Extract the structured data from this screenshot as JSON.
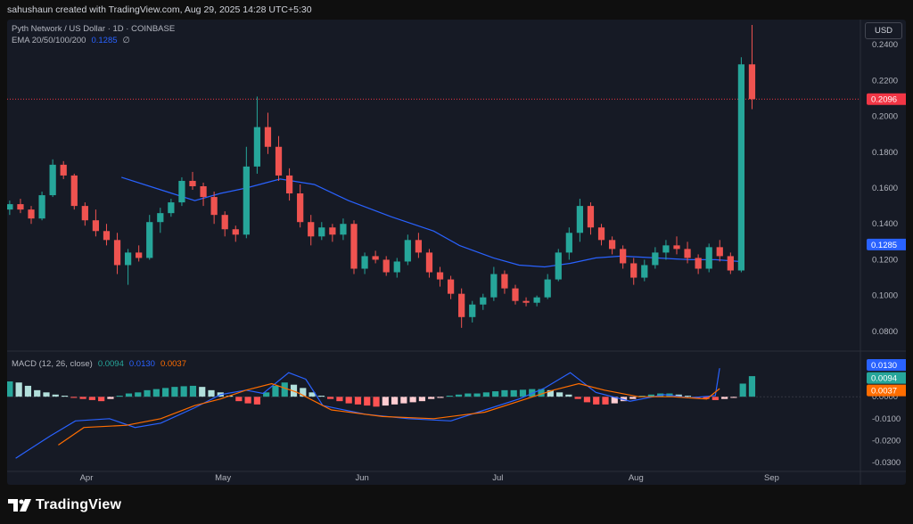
{
  "attribution": "sahushaun created with TradingView.com, Aug 29, 2025 14:28 UTC+5:30",
  "symbol_title": "Pyth Network / US Dollar · 1D · COINBASE",
  "ema_legend": {
    "label": "EMA 20/50/100/200",
    "value": "0.1285"
  },
  "macd_legend": {
    "label": "MACD (12, 26, close)",
    "histogram": "0.0094",
    "macd": "0.0130",
    "signal": "0.0037"
  },
  "currency_button": "USD",
  "brand": "TradingView",
  "colors": {
    "up": "#26a69a",
    "down": "#ef5350",
    "ema": "#2962ff",
    "signal": "#ff6d00",
    "price_line": "#f23645"
  },
  "chart_data": {
    "type": "candlestick",
    "price_axis": {
      "range": [
        0.07,
        0.25
      ],
      "ticks": [
        0.08,
        0.1,
        0.12,
        0.14,
        0.16,
        0.18,
        0.2,
        0.22,
        0.24
      ],
      "tick_labels": [
        "0.0800",
        "0.1000",
        "0.1200",
        "0.1400",
        "0.1600",
        "0.1800",
        "0.2000",
        "0.2200",
        "0.2400"
      ]
    },
    "x_axis": {
      "labels": [
        "Apr",
        "May",
        "Jun",
        "Jul",
        "Aug",
        "Sep"
      ]
    },
    "last_price": 0.2096,
    "last_price_label": "0.2096",
    "ema_value_label": "0.1285",
    "ema_points": [
      [
        0.134,
        0.166
      ],
      [
        0.18,
        0.159
      ],
      [
        0.22,
        0.153
      ],
      [
        0.25,
        0.157
      ],
      [
        0.28,
        0.16
      ],
      [
        0.32,
        0.165
      ],
      [
        0.36,
        0.162
      ],
      [
        0.4,
        0.153
      ],
      [
        0.45,
        0.144
      ],
      [
        0.5,
        0.136
      ],
      [
        0.53,
        0.128
      ],
      [
        0.57,
        0.121
      ],
      [
        0.6,
        0.117
      ],
      [
        0.63,
        0.116
      ],
      [
        0.66,
        0.118
      ],
      [
        0.69,
        0.121
      ],
      [
        0.72,
        0.122
      ],
      [
        0.76,
        0.121
      ],
      [
        0.8,
        0.12
      ],
      [
        0.83,
        0.12
      ],
      [
        0.86,
        0.119
      ]
    ],
    "candles": [
      [
        0.148,
        0.153,
        0.145,
        0.151
      ],
      [
        0.151,
        0.154,
        0.146,
        0.148
      ],
      [
        0.148,
        0.15,
        0.14,
        0.143
      ],
      [
        0.143,
        0.158,
        0.142,
        0.156
      ],
      [
        0.156,
        0.176,
        0.155,
        0.173
      ],
      [
        0.173,
        0.175,
        0.165,
        0.167
      ],
      [
        0.167,
        0.168,
        0.148,
        0.15
      ],
      [
        0.15,
        0.152,
        0.139,
        0.142
      ],
      [
        0.142,
        0.148,
        0.133,
        0.136
      ],
      [
        0.136,
        0.14,
        0.128,
        0.131
      ],
      [
        0.131,
        0.135,
        0.112,
        0.117
      ],
      [
        0.117,
        0.126,
        0.106,
        0.124
      ],
      [
        0.124,
        0.128,
        0.119,
        0.121
      ],
      [
        0.121,
        0.145,
        0.12,
        0.141
      ],
      [
        0.141,
        0.149,
        0.135,
        0.146
      ],
      [
        0.146,
        0.154,
        0.144,
        0.152
      ],
      [
        0.152,
        0.166,
        0.15,
        0.164
      ],
      [
        0.164,
        0.169,
        0.159,
        0.161
      ],
      [
        0.161,
        0.163,
        0.15,
        0.155
      ],
      [
        0.155,
        0.158,
        0.14,
        0.145
      ],
      [
        0.145,
        0.147,
        0.133,
        0.137
      ],
      [
        0.137,
        0.139,
        0.13,
        0.134
      ],
      [
        0.134,
        0.183,
        0.132,
        0.172
      ],
      [
        0.172,
        0.211,
        0.168,
        0.194
      ],
      [
        0.194,
        0.202,
        0.179,
        0.183
      ],
      [
        0.183,
        0.189,
        0.164,
        0.167
      ],
      [
        0.167,
        0.171,
        0.153,
        0.157
      ],
      [
        0.157,
        0.162,
        0.138,
        0.141
      ],
      [
        0.141,
        0.145,
        0.128,
        0.133
      ],
      [
        0.133,
        0.141,
        0.131,
        0.138
      ],
      [
        0.138,
        0.14,
        0.13,
        0.134
      ],
      [
        0.134,
        0.143,
        0.131,
        0.14
      ],
      [
        0.14,
        0.142,
        0.112,
        0.115
      ],
      [
        0.115,
        0.124,
        0.112,
        0.122
      ],
      [
        0.122,
        0.125,
        0.118,
        0.12
      ],
      [
        0.12,
        0.122,
        0.111,
        0.113
      ],
      [
        0.113,
        0.121,
        0.11,
        0.119
      ],
      [
        0.119,
        0.134,
        0.117,
        0.131
      ],
      [
        0.131,
        0.135,
        0.121,
        0.124
      ],
      [
        0.124,
        0.126,
        0.11,
        0.113
      ],
      [
        0.113,
        0.116,
        0.105,
        0.109
      ],
      [
        0.109,
        0.111,
        0.098,
        0.101
      ],
      [
        0.101,
        0.104,
        0.082,
        0.088
      ],
      [
        0.088,
        0.097,
        0.085,
        0.095
      ],
      [
        0.095,
        0.101,
        0.092,
        0.099
      ],
      [
        0.099,
        0.116,
        0.097,
        0.112
      ],
      [
        0.112,
        0.114,
        0.101,
        0.104
      ],
      [
        0.104,
        0.106,
        0.095,
        0.097
      ],
      [
        0.097,
        0.099,
        0.094,
        0.096
      ],
      [
        0.096,
        0.1,
        0.094,
        0.099
      ],
      [
        0.099,
        0.112,
        0.098,
        0.109
      ],
      [
        0.109,
        0.126,
        0.108,
        0.124
      ],
      [
        0.124,
        0.138,
        0.12,
        0.135
      ],
      [
        0.135,
        0.154,
        0.13,
        0.15
      ],
      [
        0.15,
        0.152,
        0.134,
        0.138
      ],
      [
        0.138,
        0.14,
        0.128,
        0.131
      ],
      [
        0.131,
        0.133,
        0.123,
        0.126
      ],
      [
        0.126,
        0.128,
        0.115,
        0.118
      ],
      [
        0.118,
        0.121,
        0.106,
        0.11
      ],
      [
        0.11,
        0.12,
        0.108,
        0.117
      ],
      [
        0.117,
        0.127,
        0.115,
        0.124
      ],
      [
        0.124,
        0.131,
        0.12,
        0.128
      ],
      [
        0.128,
        0.133,
        0.123,
        0.126
      ],
      [
        0.126,
        0.13,
        0.118,
        0.121
      ],
      [
        0.121,
        0.123,
        0.112,
        0.115
      ],
      [
        0.115,
        0.129,
        0.113,
        0.127
      ],
      [
        0.127,
        0.131,
        0.119,
        0.122
      ],
      [
        0.122,
        0.124,
        0.112,
        0.114
      ],
      [
        0.114,
        0.233,
        0.113,
        0.229
      ],
      [
        0.229,
        0.251,
        0.204,
        0.2096
      ]
    ],
    "macd": {
      "axis_range": [
        -0.032,
        0.02
      ],
      "ticks": [
        0.0,
        -0.01,
        -0.02,
        -0.03
      ],
      "tick_labels": [
        "0.0000",
        "-0.0100",
        "-0.0200",
        "-0.0300"
      ],
      "histogram": [
        0.007,
        0.0065,
        0.005,
        0.003,
        0.002,
        0.001,
        0.0005,
        -0.0005,
        -0.001,
        -0.0015,
        -0.002,
        -0.001,
        0.0005,
        0.0015,
        0.002,
        0.003,
        0.0035,
        0.004,
        0.0045,
        0.0048,
        0.005,
        0.0045,
        0.003,
        0.002,
        0.0005,
        -0.002,
        -0.003,
        -0.0035,
        0.002,
        0.005,
        0.0065,
        0.0055,
        0.004,
        0.002,
        0.0005,
        -0.001,
        -0.002,
        -0.003,
        -0.0035,
        -0.004,
        -0.0045,
        -0.004,
        -0.0035,
        -0.003,
        -0.0025,
        -0.002,
        -0.001,
        -0.0005,
        0.0005,
        0.001,
        0.0015,
        0.0015,
        0.002,
        0.0025,
        0.003,
        0.003,
        0.0032,
        0.0035,
        0.0035,
        0.003,
        0.002,
        0.001,
        -0.001,
        -0.0025,
        -0.0035,
        -0.0035,
        -0.003,
        -0.002,
        -0.001,
        0.0005,
        0.001,
        0.0015,
        0.0015,
        0.001,
        0.0005,
        -0.0005,
        -0.001,
        -0.0015,
        -0.001,
        -0.0005,
        0.006,
        0.0094
      ],
      "macd_line": [
        [
          0.01,
          -0.028
        ],
        [
          0.05,
          -0.018
        ],
        [
          0.08,
          -0.011
        ],
        [
          0.12,
          -0.01
        ],
        [
          0.15,
          -0.014
        ],
        [
          0.18,
          -0.012
        ],
        [
          0.22,
          -0.005
        ],
        [
          0.25,
          0.001
        ],
        [
          0.28,
          0.003
        ],
        [
          0.3,
          0.0015
        ],
        [
          0.33,
          0.011
        ],
        [
          0.35,
          0.008
        ],
        [
          0.37,
          -0.004
        ],
        [
          0.42,
          -0.008
        ],
        [
          0.47,
          -0.01
        ],
        [
          0.52,
          -0.011
        ],
        [
          0.56,
          -0.006
        ],
        [
          0.6,
          -0.001
        ],
        [
          0.63,
          0.004
        ],
        [
          0.66,
          0.011
        ],
        [
          0.69,
          0.002
        ],
        [
          0.73,
          -0.002
        ],
        [
          0.77,
          0.001
        ],
        [
          0.8,
          -0.0005
        ],
        [
          0.83,
          0.0005
        ],
        [
          0.835,
          0.013
        ]
      ],
      "signal_line": [
        [
          0.06,
          -0.022
        ],
        [
          0.09,
          -0.014
        ],
        [
          0.14,
          -0.013
        ],
        [
          0.18,
          -0.01
        ],
        [
          0.22,
          -0.004
        ],
        [
          0.25,
          -0.001
        ],
        [
          0.28,
          0.003
        ],
        [
          0.31,
          0.006
        ],
        [
          0.34,
          0.002
        ],
        [
          0.38,
          -0.006
        ],
        [
          0.44,
          -0.009
        ],
        [
          0.5,
          -0.01
        ],
        [
          0.56,
          -0.007
        ],
        [
          0.6,
          -0.002
        ],
        [
          0.64,
          0.003
        ],
        [
          0.67,
          0.006
        ],
        [
          0.7,
          0.003
        ],
        [
          0.74,
          0.0
        ],
        [
          0.78,
          0.0
        ],
        [
          0.82,
          -0.001
        ],
        [
          0.835,
          0.0037
        ]
      ],
      "value_labels": [
        "0.0130",
        "0.0094",
        "0.0037"
      ]
    }
  }
}
